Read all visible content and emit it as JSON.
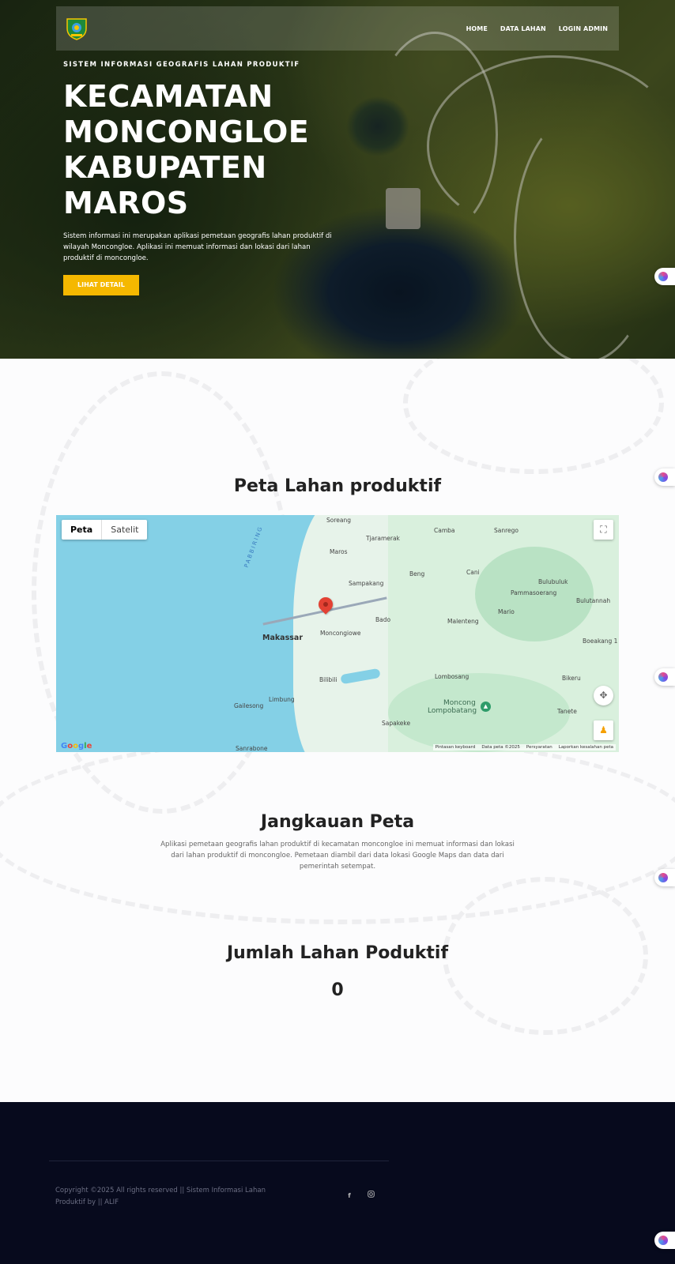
{
  "nav": {
    "links": [
      "HOME",
      "DATA LAHAN",
      "LOGIN ADMIN"
    ]
  },
  "hero": {
    "eyebrow": "SISTEM INFORMASI GEOGRAFIS LAHAN PRODUKTIF",
    "title": "KECAMATAN MONCONGLOE KABUPATEN MAROS",
    "description": "Sistem informasi ini merupakan aplikasi pemetaan geografis lahan produktif di wilayah Moncongloe. Aplikasi ini memuat informasi dan lokasi dari lahan produktif di moncongloe.",
    "button_label": "LIHAT DETAIL"
  },
  "map_section": {
    "title": "Peta Lahan produktif",
    "map": {
      "type_options": [
        "Peta",
        "Satelit"
      ],
      "selected_type": "Peta",
      "labels": {
        "soreang": "Soreang",
        "tjaramerak": "Tjaramerak",
        "camba": "Camba",
        "sanrego": "Sanrego",
        "maros": "Maros",
        "pabbiring": "PABBIRING",
        "beng": "Beng",
        "cani": "Cani",
        "bulubuluk": "Bulubuluk",
        "sampakang": "Sampakang",
        "pammasoerang": "Pammasoerang",
        "bulutannah": "Bulutannah",
        "mario": "Mario",
        "bado": "Bado",
        "malenteng": "Malenteng",
        "makassar": "Makassar",
        "moncongiowe": "Moncongiowe",
        "boeakang": "Boeakang 1",
        "lombosang": "Lombosang",
        "bilibili": "Bilibili",
        "bikeru": "Bikeru",
        "moncong": "Moncong",
        "lompobatang": "Lompobatang",
        "limbung": "Limbung",
        "gailesong": "Gailesong",
        "tanete": "Tanete",
        "sapakeke": "Sapakeke",
        "sanrabone": "Sanrabone"
      },
      "logo": "Google",
      "footer_links": [
        "Pintasan keyboard",
        "Data peta ©2025",
        "Persyaratan",
        "Laporkan kesalahan peta"
      ],
      "icons": [
        "fullscreen-icon",
        "camera-control-icon",
        "pegman-icon",
        "location-marker-icon",
        "mountain-poi-icon"
      ]
    }
  },
  "jangkauan": {
    "title": "Jangkauan Peta",
    "description": "Aplikasi pemetaan geografis lahan produktif di kecamatan moncongloe ini memuat informasi dan lokasi dari lahan produktif di moncongloe. Pemetaan diambil dari data lokasi Google Maps dan data dari pemerintah setempat."
  },
  "jumlah": {
    "title": "Jumlah Lahan Poduktif",
    "count": "0"
  },
  "footer": {
    "copyright": "Copyright ©2025 All rights reserved || Sistem Informasi Lahan Produktif by || ALIF",
    "social_icons": [
      "facebook-icon",
      "instagram-icon"
    ]
  },
  "colors": {
    "accent": "#f5b800",
    "footer_bg": "#070a1d",
    "map_marker": "#e34133"
  }
}
